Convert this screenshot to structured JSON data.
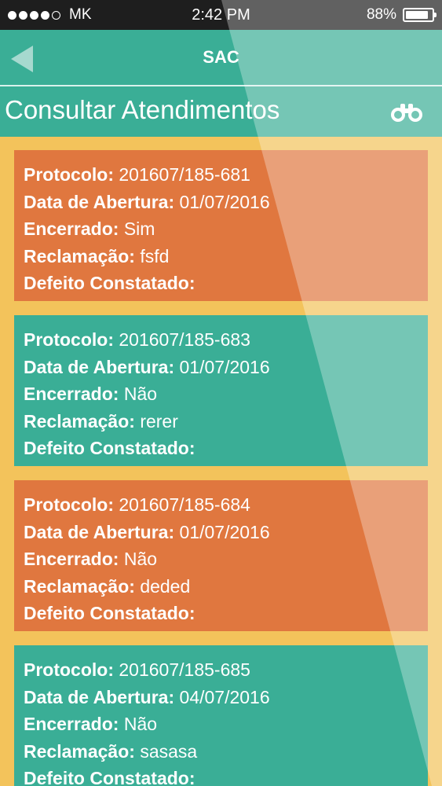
{
  "status_bar": {
    "signal_dots": [
      true,
      true,
      true,
      true,
      false
    ],
    "carrier": "MK",
    "time": "2:42 PM",
    "battery_percent": "88%",
    "battery_level": 0.88
  },
  "header": {
    "back_icon": "back-arrow-icon",
    "title": "SAC"
  },
  "page": {
    "title": "Consultar Atendimentos",
    "search_icon": "binoculars-icon"
  },
  "labels": {
    "protocolo": "Protocolo:",
    "data_abertura": "Data de Abertura:",
    "encerrado": "Encerrado:",
    "reclamacao": "Reclamação:",
    "defeito": "Defeito Constatado:"
  },
  "tickets": [
    {
      "protocolo": "201607/185-681",
      "data_abertura": "01/07/2016",
      "encerrado": "Sim",
      "reclamacao": "fsfd",
      "defeito": "",
      "color": "#e0773f"
    },
    {
      "protocolo": "201607/185-683",
      "data_abertura": "01/07/2016",
      "encerrado": "Não",
      "reclamacao": "rerer",
      "defeito": "",
      "color": "#3aae96"
    },
    {
      "protocolo": "201607/185-684",
      "data_abertura": "01/07/2016",
      "encerrado": "Não",
      "reclamacao": "deded",
      "defeito": "",
      "color": "#e0773f"
    },
    {
      "protocolo": "201607/185-685",
      "data_abertura": "04/07/2016",
      "encerrado": "Não",
      "reclamacao": "sasasa",
      "defeito": "",
      "color": "#3aae96"
    }
  ],
  "colors": {
    "teal": "#3aae96",
    "orange": "#e0773f",
    "background_yellow": "#f3c35b"
  }
}
